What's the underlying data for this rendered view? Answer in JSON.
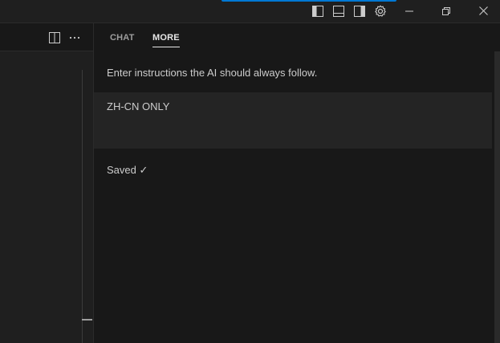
{
  "panel": {
    "tabs": [
      {
        "label": "CHAT",
        "active": false
      },
      {
        "label": "MORE",
        "active": true
      }
    ],
    "instructions_text": "Enter instructions the AI should always follow.",
    "custom_instructions_value": "ZH-CN ONLY",
    "status_text": "Saved ✓"
  },
  "icons": {
    "titlebar": [
      "toggle-primary-sidebar-icon",
      "toggle-panel-icon",
      "toggle-secondary-sidebar-icon",
      "settings-gear-icon"
    ],
    "window_controls": [
      "minimize-icon",
      "restore-icon",
      "close-icon"
    ],
    "editor_toolbar": [
      "split-editor-icon",
      "more-actions-icon"
    ]
  },
  "colors": {
    "accent": "#0078d4",
    "background": "#1f1f1f",
    "panel_background": "#181818",
    "input_background": "#242424",
    "text": "#cccccc",
    "active_tab": "#e7e7e7"
  }
}
